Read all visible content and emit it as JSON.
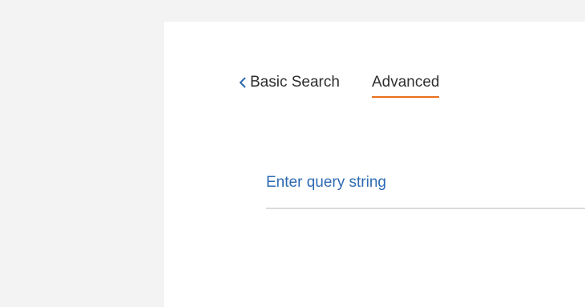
{
  "search": {
    "tabs": {
      "basic_label": "Basic Search",
      "advanced_label": "Advanced"
    },
    "query": {
      "placeholder": "Enter query string",
      "value": ""
    }
  },
  "colors": {
    "accent_underline": "#e9711c",
    "link_blue": "#2e6ab3",
    "background": "#f3f3f3",
    "panel": "#ffffff"
  },
  "icons": {
    "back": "chevron-left-icon"
  }
}
